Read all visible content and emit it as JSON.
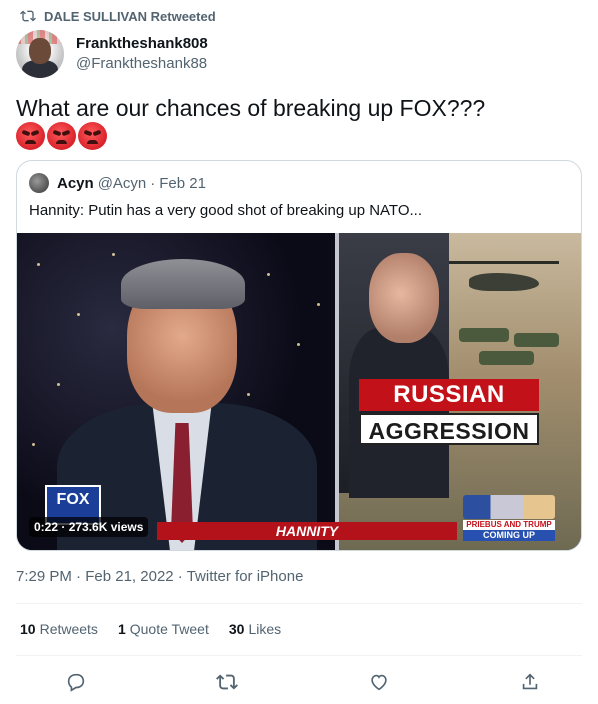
{
  "retweeted_by": "DALE SULLIVAN Retweeted",
  "author": {
    "display_name": "Franktheshank808",
    "handle": "@Franktheshank88"
  },
  "tweet": {
    "text": "What are our chances of breaking up FOX???",
    "emojis": [
      "pouting-face",
      "pouting-face",
      "pouting-face"
    ]
  },
  "quoted_tweet": {
    "name": "Acyn",
    "handle": "@Acyn",
    "separator": "·",
    "date": "Feb 21",
    "text": "Hannity: Putin has a very good shot of breaking up NATO...",
    "video": {
      "headline_line1": "RUSSIAN",
      "headline_line2": "AGGRESSION",
      "lower_third": "HANNITY",
      "network_logo": "FOX",
      "coming_up_title": "PRIEBUS AND TRUMP",
      "coming_up_label": "COMING UP",
      "time": "0:22",
      "views": "273.6K views"
    }
  },
  "meta": {
    "time": "7:29 PM",
    "date": "Feb 21, 2022",
    "source": "Twitter for iPhone",
    "separator": "·"
  },
  "stats": {
    "retweets_count": "10",
    "retweets_label": "Retweets",
    "quotes_count": "1",
    "quotes_label": "Quote Tweet",
    "likes_count": "30",
    "likes_label": "Likes"
  },
  "colors": {
    "text": "#0f1419",
    "secondary": "#536471",
    "border": "#cfd9de",
    "fox_red": "#c3111a"
  }
}
